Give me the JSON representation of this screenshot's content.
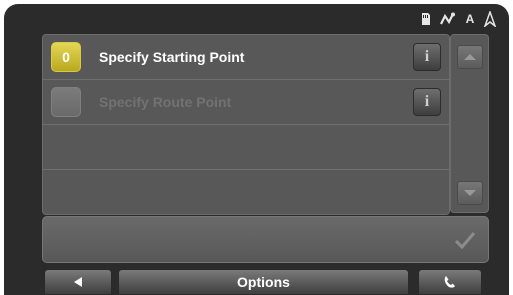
{
  "status_bar": {
    "icons": [
      "memory-card-icon",
      "signal-icon",
      "tmc-icon",
      "gps-icon"
    ],
    "tmc_label": "A"
  },
  "route_list": {
    "rows": [
      {
        "number": "0",
        "label": "Specify Starting Point",
        "state": "active"
      },
      {
        "number": "",
        "label": "Specify Route Point",
        "state": "inactive"
      },
      {
        "number": "",
        "label": "",
        "state": "empty"
      },
      {
        "number": "",
        "label": "",
        "state": "empty"
      }
    ]
  },
  "toolbar": {
    "options_label": "Options"
  },
  "colors": {
    "active_badge": "#c9bb2f",
    "inactive_text": "#727272",
    "panel": "#585858",
    "background": "#2b2b2b"
  }
}
